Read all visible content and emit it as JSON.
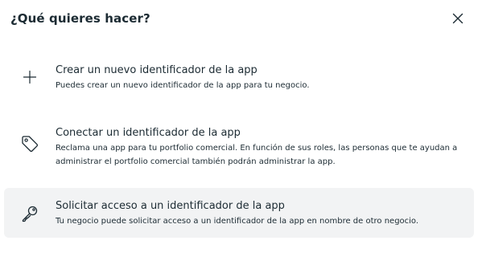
{
  "dialog": {
    "title": "¿Qué quieres hacer?",
    "close_icon": "close-icon"
  },
  "options": [
    {
      "icon": "plus-icon",
      "title": "Crear un nuevo identificador de la app",
      "description": "Puedes crear un nuevo identificador de la app para tu negocio.",
      "selected": false
    },
    {
      "icon": "tag-icon",
      "title": "Conectar un identificador de la app",
      "description": "Reclama una app para tu portfolio comercial. En función de sus roles, las personas que te ayudan a administrar el portfolio comercial también podrán administrar la app.",
      "selected": false
    },
    {
      "icon": "key-icon",
      "title": "Solicitar acceso a un identificador de la app",
      "description": "Tu negocio puede solicitar acceso a un identificador de la app en nombre de otro negocio.",
      "selected": true
    }
  ],
  "colors": {
    "text": "#1c2b33",
    "selected_background": "#f2f3f4"
  }
}
